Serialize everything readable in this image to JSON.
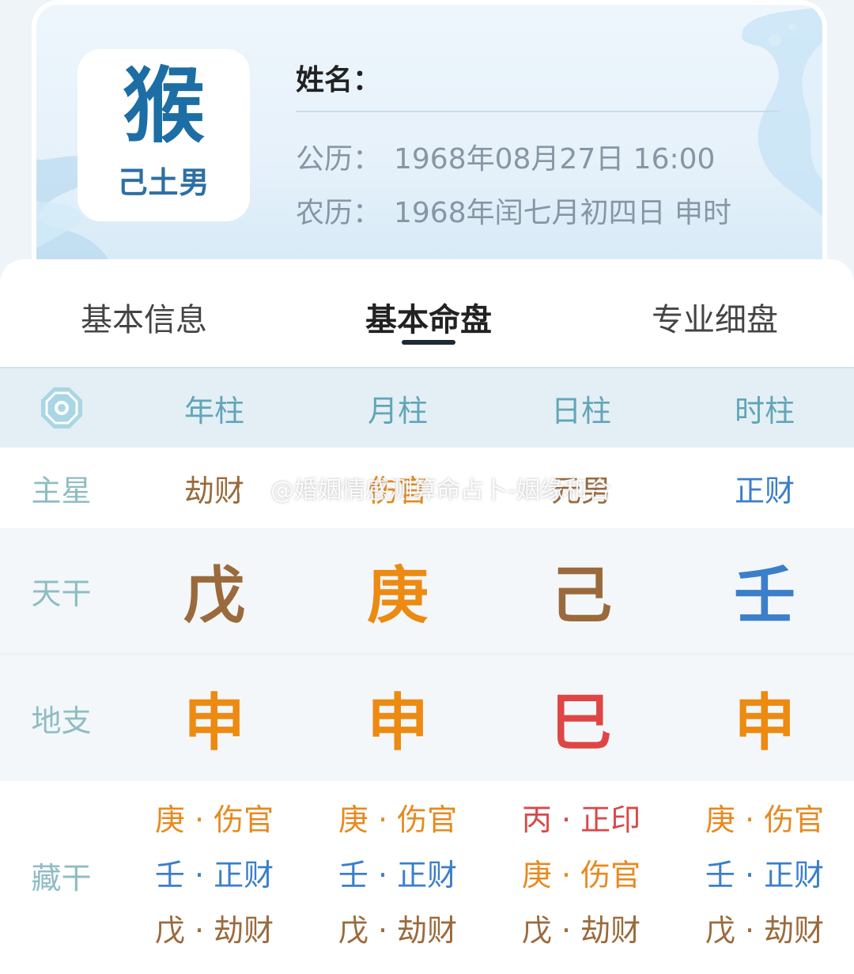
{
  "profile": {
    "zodiac": "猴",
    "element_gender": "己土男",
    "name_label": "姓名：",
    "solar_label": "公历：",
    "solar_value": "1968年08月27日 16:00",
    "lunar_label": "农历：",
    "lunar_value": "1968年闰七月初四日 申时"
  },
  "tabs": [
    {
      "label": "基本信息",
      "active": false
    },
    {
      "label": "基本命盘",
      "active": true
    },
    {
      "label": "专业细盘",
      "active": false
    }
  ],
  "columns": [
    "年柱",
    "月柱",
    "日柱",
    "时柱"
  ],
  "rows": {
    "main_star": {
      "label": "主星",
      "values": [
        "劫财",
        "伤官",
        "元男",
        "正财"
      ],
      "colors": [
        "#9b6a3c",
        "#e8891f",
        "#9b6a3c",
        "#3b7fc9"
      ]
    },
    "heavenly_stem": {
      "label": "天干",
      "values": [
        "戊",
        "庚",
        "己",
        "壬"
      ],
      "colors": [
        "#9b6a3c",
        "#ec8a12",
        "#9b6a3c",
        "#3b7fc9"
      ]
    },
    "earthly_branch": {
      "label": "地支",
      "values": [
        "申",
        "申",
        "巳",
        "申"
      ],
      "colors": [
        "#ec8a12",
        "#ec8a12",
        "#e04545",
        "#ec8a12"
      ]
    },
    "hidden_stems": {
      "label": "藏干",
      "columns": [
        [
          {
            "text": "庚 · 伤官",
            "color": "#e8891f"
          },
          {
            "text": "壬 · 正财",
            "color": "#3b7fc9"
          },
          {
            "text": "戊 · 劫财",
            "color": "#9b6a3c"
          }
        ],
        [
          {
            "text": "庚 · 伤官",
            "color": "#e8891f"
          },
          {
            "text": "壬 · 正财",
            "color": "#3b7fc9"
          },
          {
            "text": "戊 · 劫财",
            "color": "#9b6a3c"
          }
        ],
        [
          {
            "text": "丙 · 正印",
            "color": "#d94848"
          },
          {
            "text": "庚 · 伤官",
            "color": "#e8891f"
          },
          {
            "text": "戊 · 劫财",
            "color": "#9b6a3c"
          }
        ],
        [
          {
            "text": "庚 · 伤官",
            "color": "#e8891f"
          },
          {
            "text": "壬 · 正财",
            "color": "#3b7fc9"
          },
          {
            "text": "戊 · 劫财",
            "color": "#9b6a3c"
          }
        ]
      ]
    }
  },
  "watermark": "@婚姻情感测算命占卜-姻缘和合",
  "icons": {
    "bagua": "bagua-icon",
    "weibo": "weibo-icon"
  }
}
